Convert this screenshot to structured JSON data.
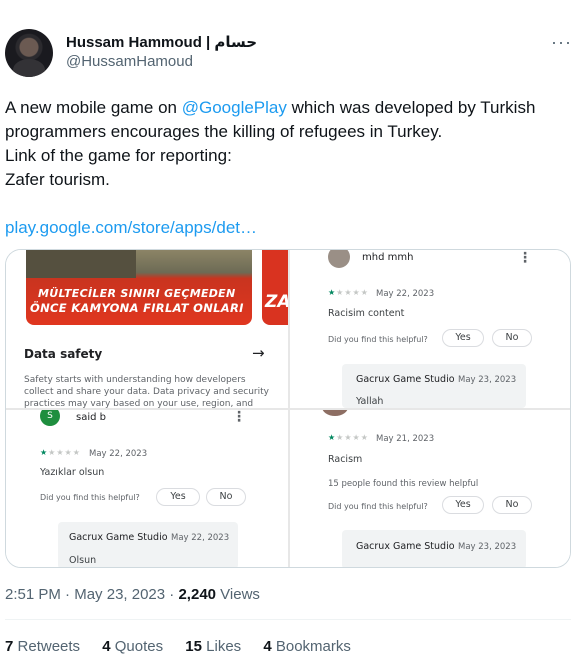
{
  "author": {
    "display_name": "Hussam Hammoud",
    "arabic_name": "حسام",
    "handle": "@HussamHamoud",
    "more_label": "···"
  },
  "tweet": {
    "line1_pre": "A new mobile game on ",
    "mention": "@GooglePlay",
    "line1_post": " which was developed by Turkish",
    "line2": "programmers encourages the killing of refugees in Turkey.",
    "line3": "Link of the game for reporting:",
    "line4": "Zafer tourism.",
    "link": "play.google.com/store/apps/det…"
  },
  "media": {
    "tile1": {
      "banner_line1": "MÜLTECİLER SINIRI GEÇMEDEN",
      "banner_line2": "ÖNCE KAMYONA FIRLAT ONLARI",
      "side_banner_text": "ZA",
      "data_safety_title": "Data safety",
      "data_safety_arrow": "→",
      "data_safety_text": "Safety starts with understanding how developers collect and share your data. Data privacy and security practices may vary based on your use, region, and age. The"
    },
    "tile2": {
      "reviewer": "mhd mmh",
      "date": "May 22, 2023",
      "review_text": "Racisim content",
      "helpful_q": "Did you find this helpful?",
      "yes": "Yes",
      "no": "No",
      "dev_name": "Gacrux Game Studio",
      "dev_date": "May 23, 2023",
      "reply": "Yallah"
    },
    "tile3": {
      "avatar_letter": "S",
      "reviewer": "said b",
      "date": "May 22, 2023",
      "review_text": "Yazıklar olsun",
      "helpful_q": "Did you find this helpful?",
      "yes": "Yes",
      "no": "No",
      "dev_name": "Gacrux Game Studio",
      "dev_date": "May 22, 2023",
      "reply": "Olsun"
    },
    "tile4": {
      "date": "May 21, 2023",
      "review_text": "Racism",
      "helpful_count": "15 people found this review helpful",
      "helpful_q": "Did you find this helpful?",
      "yes": "Yes",
      "no": "No",
      "dev_name": "Gacrux Game Studio",
      "dev_date": "May 23, 2023"
    },
    "menu_icon": "⋮",
    "star_on": "★",
    "star_off": "★★★★"
  },
  "meta": {
    "time": "2:51 PM",
    "separator": " · ",
    "date": "May 23, 2023",
    "views_count": "2,240",
    "views_label": " Views"
  },
  "stats": {
    "retweets_count": "7",
    "retweets_label": "Retweets",
    "quotes_count": "4",
    "quotes_label": "Quotes",
    "likes_count": "15",
    "likes_label": "Likes",
    "bookmarks_count": "4",
    "bookmarks_label": "Bookmarks"
  }
}
